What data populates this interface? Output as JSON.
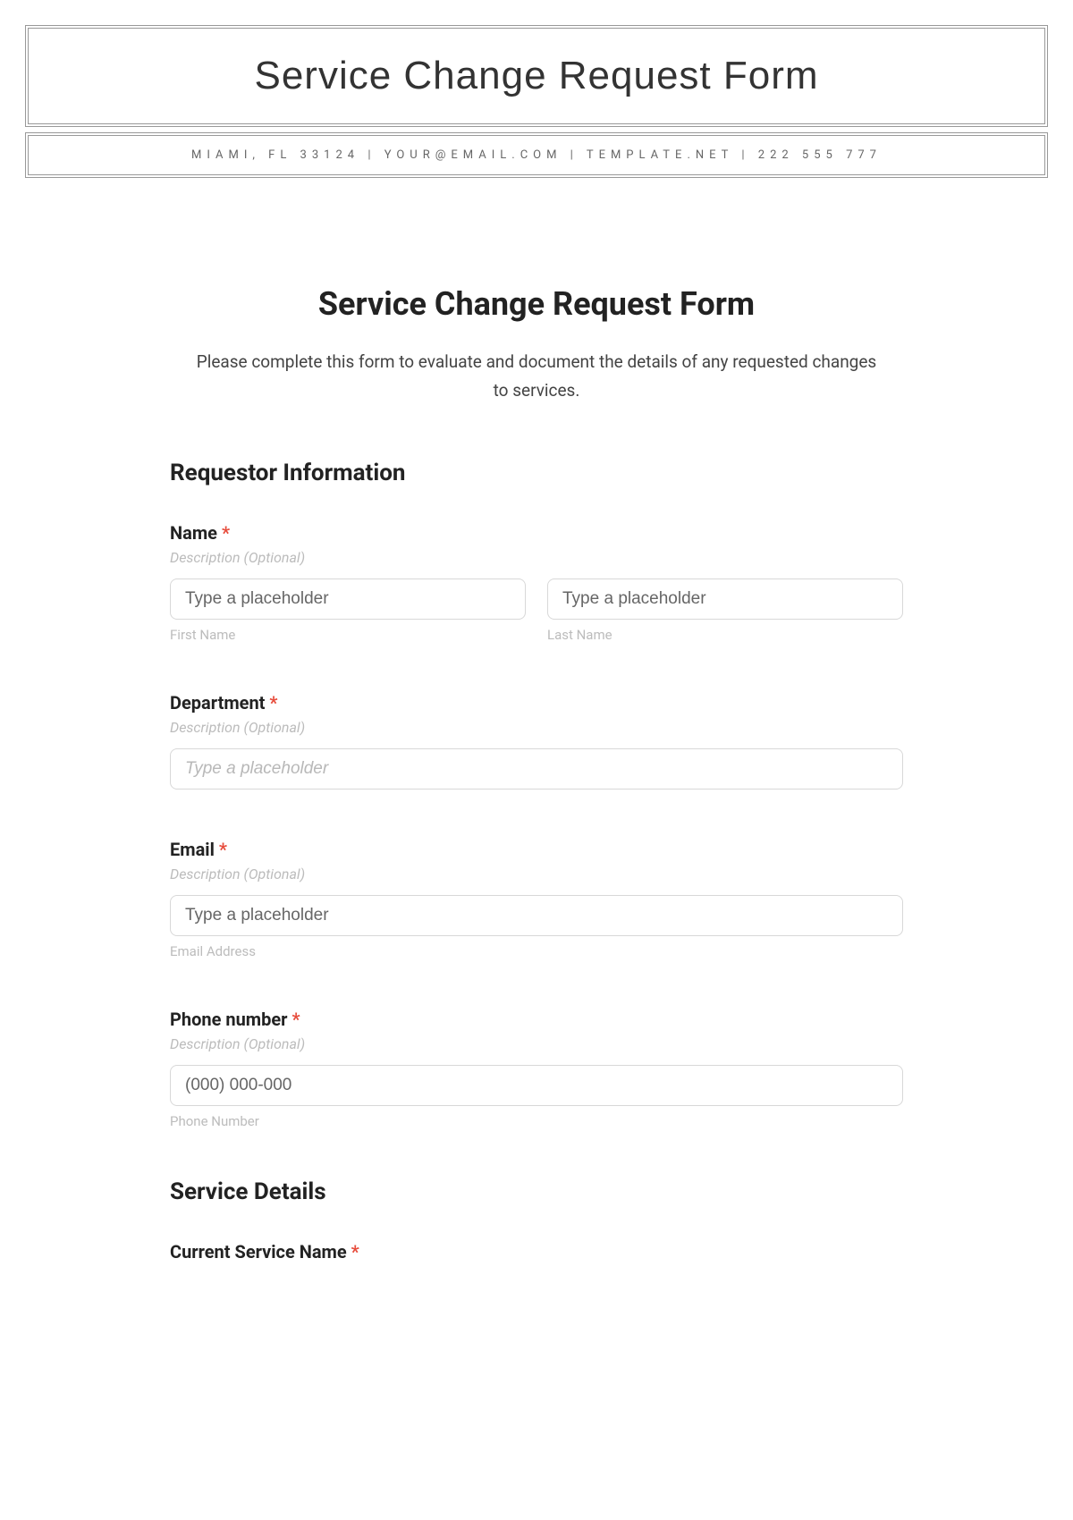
{
  "banner": {
    "title": "Service Change Request Form",
    "contact": "MIAMI, FL 33124 | YOUR@EMAIL.COM | TEMPLATE.NET | 222 555 777"
  },
  "form": {
    "title": "Service Change Request Form",
    "intro": "Please complete this form to evaluate and document the details of any requested changes to services.",
    "section_requestor": "Requestor Information",
    "section_service": "Service Details",
    "required_mark": "*",
    "desc_optional": "Description (Optional)",
    "name": {
      "label": "Name",
      "first_placeholder": "Type a placeholder",
      "first_sub": "First Name",
      "last_placeholder": "Type a placeholder",
      "last_sub": "Last Name"
    },
    "department": {
      "label": "Department",
      "placeholder": "Type a placeholder"
    },
    "email": {
      "label": "Email",
      "placeholder": "Type a placeholder",
      "sub": "Email Address"
    },
    "phone": {
      "label": "Phone number",
      "placeholder": "(000) 000-000",
      "sub": "Phone Number"
    },
    "current_service": {
      "label": "Current Service Name"
    }
  }
}
